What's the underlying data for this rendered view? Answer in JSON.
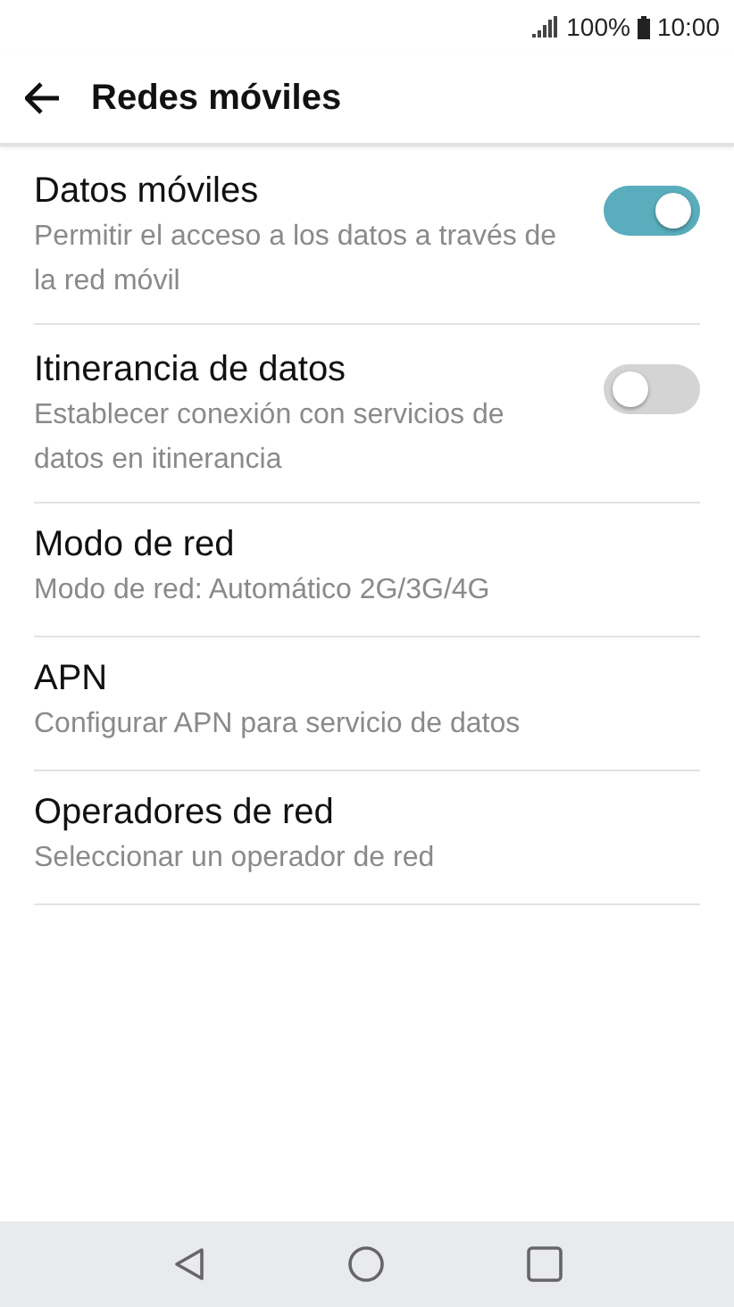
{
  "status_bar": {
    "battery": "100%",
    "time": "10:00"
  },
  "header": {
    "title": "Redes móviles"
  },
  "settings": [
    {
      "kind": "toggle",
      "title": "Datos móviles",
      "summary": "Permitir el acceso a los datos a través de la red móvil",
      "on": true
    },
    {
      "kind": "toggle",
      "title": "Itinerancia de datos",
      "summary": "Establecer conexión con servicios de datos en itinerancia",
      "on": false
    },
    {
      "kind": "text",
      "title": "Modo de red",
      "summary": "Modo de red: Automático 2G/3G/4G"
    },
    {
      "kind": "text",
      "title": "APN",
      "summary": "Configurar APN para servicio de datos"
    },
    {
      "kind": "text",
      "title": "Operadores de red",
      "summary": "Seleccionar un operador de red"
    }
  ]
}
